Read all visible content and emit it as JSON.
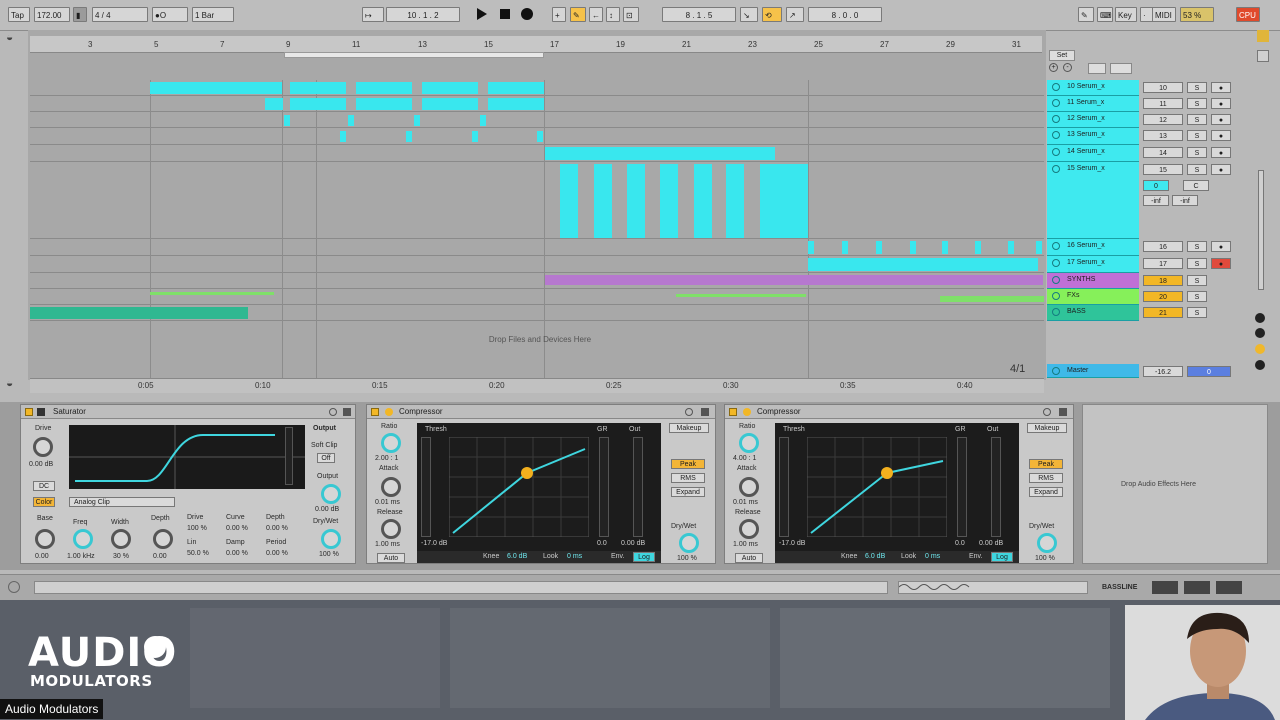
{
  "transport": {
    "tap": "Tap",
    "tempo": "172.00",
    "time_sig": "4 / 4",
    "metro": "●O",
    "quant": "1 Bar",
    "position": "10 . 1 . 2",
    "loop_start": "8 . 1 . 5",
    "loop_len": "8 . 0 . 0",
    "key": "Key",
    "midi": "MIDI",
    "cpu_value": "53 %",
    "cpu": "CPU"
  },
  "ruler": [
    "3",
    "5",
    "7",
    "9",
    "11",
    "13",
    "15",
    "17",
    "19",
    "21",
    "23",
    "25",
    "27",
    "29",
    "31"
  ],
  "timeline": [
    "0:05",
    "0:10",
    "0:15",
    "0:20",
    "0:25",
    "0:30",
    "0:35",
    "0:40"
  ],
  "drop_files": "Drop Files and Devices Here",
  "set_label": "Set",
  "counter": "4/1",
  "tracks": [
    {
      "name": "10 Serum_x",
      "num": "10",
      "s": "S",
      "color": "#3fe9ef"
    },
    {
      "name": "11 Serum_x",
      "num": "11",
      "s": "S",
      "color": "#3fe9ef"
    },
    {
      "name": "12 Serum_x",
      "num": "12",
      "s": "S",
      "color": "#3fe9ef"
    },
    {
      "name": "13 Serum_x",
      "num": "13",
      "s": "S",
      "color": "#3fe9ef"
    },
    {
      "name": "14 Serum_x",
      "num": "14",
      "s": "S",
      "color": "#3fe9ef"
    },
    {
      "name": "15 Serum_x",
      "num": "15",
      "s": "S",
      "color": "#3fe9ef"
    },
    {
      "name": "16 Serum_x",
      "num": "16",
      "s": "S",
      "color": "#3fe9ef"
    },
    {
      "name": "17 Serum_x",
      "num": "17",
      "s": "S",
      "color": "#3fe9ef"
    },
    {
      "name": "SYNTHS",
      "num": "18",
      "s": "S",
      "color": "#c06fd6"
    },
    {
      "name": "FXs",
      "num": "20",
      "s": "S",
      "color": "#86f05a"
    },
    {
      "name": "BASS",
      "num": "21",
      "s": "S",
      "color": "#2fc49a"
    }
  ],
  "track15_extra": {
    "vol": "0",
    "pan": "C",
    "in": "-inf",
    "out": "-inf"
  },
  "master": {
    "name": "Master",
    "vol": "-16.2",
    "num": "0"
  },
  "saturator": {
    "title": "Saturator",
    "drive_label": "Drive",
    "drive_value": "0.00 dB",
    "dc": "DC",
    "color": "Color",
    "mode": "Analog Clip",
    "output_label": "Output",
    "soft_clip": "Soft Clip",
    "soft_clip_state": "Off",
    "output_value": "0.00 dB",
    "drywet_label": "Dry/Wet",
    "drywet_value": "100 %",
    "base_label": "Base",
    "base_value": "0.00",
    "freq_label": "Freq",
    "freq_value": "1.00 kHz",
    "width_label": "Width",
    "width_value": "30 %",
    "depth_label": "Depth",
    "depth_value": "0.00",
    "drive2": "Drive",
    "drive2_value": "100 %",
    "lin": "Lin",
    "lin_value": "50.0 %",
    "curve": "Curve",
    "curve_value": "0.00 %",
    "damp": "Damp",
    "damp_value": "0.00 %",
    "depth2": "Depth",
    "depth2_value": "0.00 %",
    "period": "Period",
    "period_value": "0.00 %"
  },
  "comp1": {
    "title": "Compressor",
    "ratio_label": "Ratio",
    "ratio_value": "2.00 : 1",
    "attack_label": "Attack",
    "attack_value": "0.01 ms",
    "release_label": "Release",
    "release_value": "1.00 ms",
    "auto": "Auto",
    "thresh": "Thresh",
    "gr": "GR",
    "out": "Out",
    "thresh_value": "-17.0 dB",
    "gr_value": "0.0",
    "out_value": "0.00 dB",
    "makeup": "Makeup",
    "peak": "Peak",
    "rms": "RMS",
    "expand": "Expand",
    "drywet_label": "Dry/Wet",
    "drywet_value": "100 %",
    "knee": "Knee",
    "knee_value": "6.0 dB",
    "look": "Look",
    "look_value": "0 ms",
    "env": "Env.",
    "log": "Log"
  },
  "comp2": {
    "title": "Compressor",
    "ratio_label": "Ratio",
    "ratio_value": "4.00 : 1",
    "attack_label": "Attack",
    "attack_value": "0.01 ms",
    "release_label": "Release",
    "release_value": "1.00 ms",
    "auto": "Auto",
    "thresh": "Thresh",
    "gr": "GR",
    "out": "Out",
    "thresh_value": "-17.0 dB",
    "gr_value": "0.0",
    "out_value": "0.00 dB",
    "makeup": "Makeup",
    "peak": "Peak",
    "rms": "RMS",
    "expand": "Expand",
    "drywet_label": "Dry/Wet",
    "drywet_value": "100 %",
    "knee": "Knee",
    "knee_value": "6.0 dB",
    "look": "Look",
    "look_value": "0 ms",
    "env": "Env.",
    "log": "Log"
  },
  "drop_effects": "Drop Audio Effects Here",
  "bassline": "BASSLINE",
  "logo": {
    "line1": "AUDIO",
    "line2": "MODULATORS"
  },
  "caption": "Audio Modulators"
}
